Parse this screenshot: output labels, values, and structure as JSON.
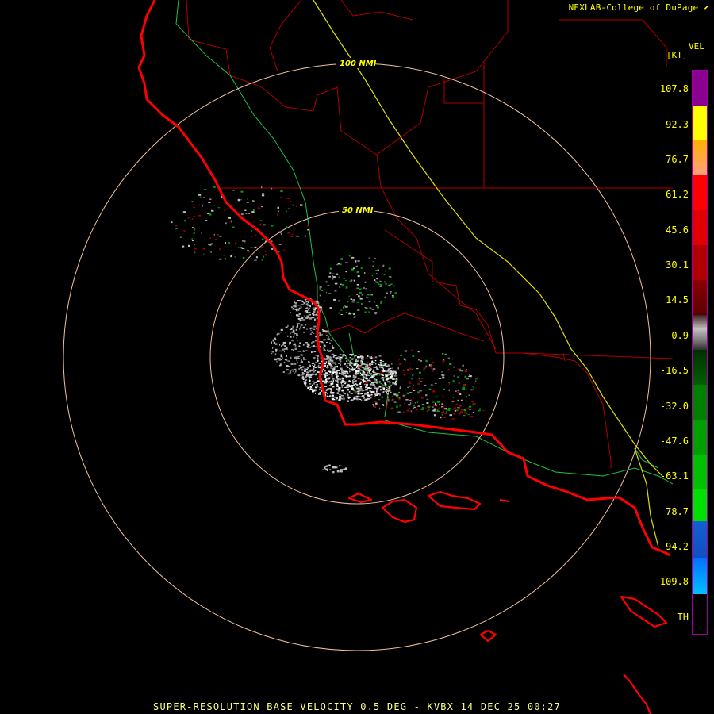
{
  "credit": "NEXLAB-College of DuPage",
  "product_label": "VEL",
  "unit_label": "[KT]",
  "ring_labels": [
    "100 NMI",
    "50 NMI"
  ],
  "scale_ticks": [
    "107.8",
    "92.3",
    "76.7",
    "61.2",
    "45.6",
    "30.1",
    "14.5",
    "-0.9",
    "-16.5",
    "-32.0",
    "-47.6",
    "-63.1",
    "-78.7",
    "-94.2",
    "-109.8",
    "TH"
  ],
  "footer": "SUPER-RESOLUTION BASE VELOCITY 0.5 DEG - KVBX 14 DEC 25 00:27",
  "colors": {
    "coastline": "#ff0000",
    "county_lines": "#b00000",
    "highway": "#e0e000",
    "roads": "#20c040",
    "range_rings": "#f0c0a0"
  },
  "icons": {
    "credit": "logo-icon"
  }
}
